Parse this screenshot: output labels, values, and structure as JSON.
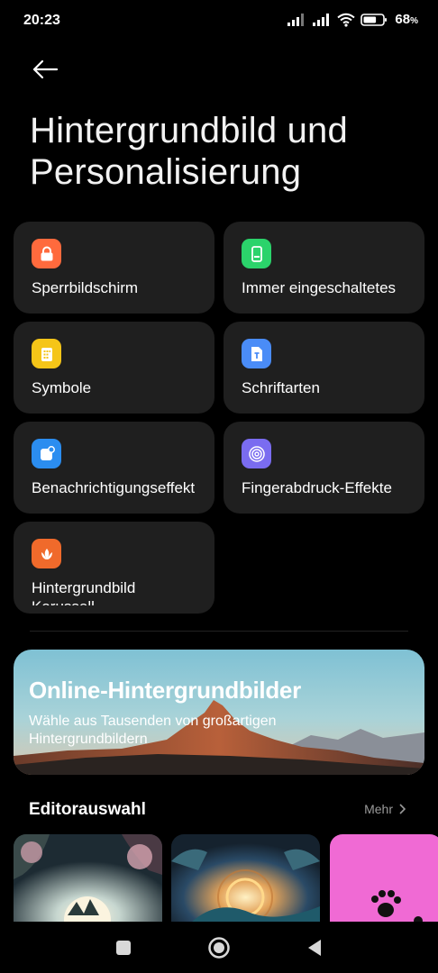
{
  "status_bar": {
    "time": "20:23",
    "battery_percent": "68",
    "battery_unit": "%",
    "battery_level": 0.68
  },
  "header": {
    "back_icon": "arrow-left-icon",
    "title": "Hintergrundbild und Personalisierung"
  },
  "tiles": [
    {
      "label": "Sperrbildschirm",
      "icon": "lock-icon",
      "color": "#ff6a3d"
    },
    {
      "label": "Immer eingeschaltetes Display",
      "icon": "display-icon",
      "color": "#2bd36b"
    },
    {
      "label": "Symbole",
      "icon": "apps-icon",
      "color": "#f5c518"
    },
    {
      "label": "Schriftarten",
      "icon": "font-file-icon",
      "color": "#4a8cf7"
    },
    {
      "label": "Benachrichtigungseffekt",
      "icon": "notification-icon",
      "color": "#2b8df0"
    },
    {
      "label": "Fingerabdruck-Effekte",
      "icon": "fingerprint-icon",
      "color": "#7a6cf0"
    },
    {
      "label": "Hintergrundbild Karussell",
      "icon": "carousel-flower-icon",
      "color": "#f06a2b"
    }
  ],
  "banner": {
    "title": "Online-Hintergrundbilder",
    "subtitle": "Wähle aus Tausenden von großartigen Hintergrundbildern"
  },
  "editor": {
    "title": "Editorauswahl",
    "more": "Mehr"
  },
  "colors": {
    "background": "#000000",
    "tile_background": "#1f1f1f",
    "muted_text": "#9a9a9a"
  }
}
